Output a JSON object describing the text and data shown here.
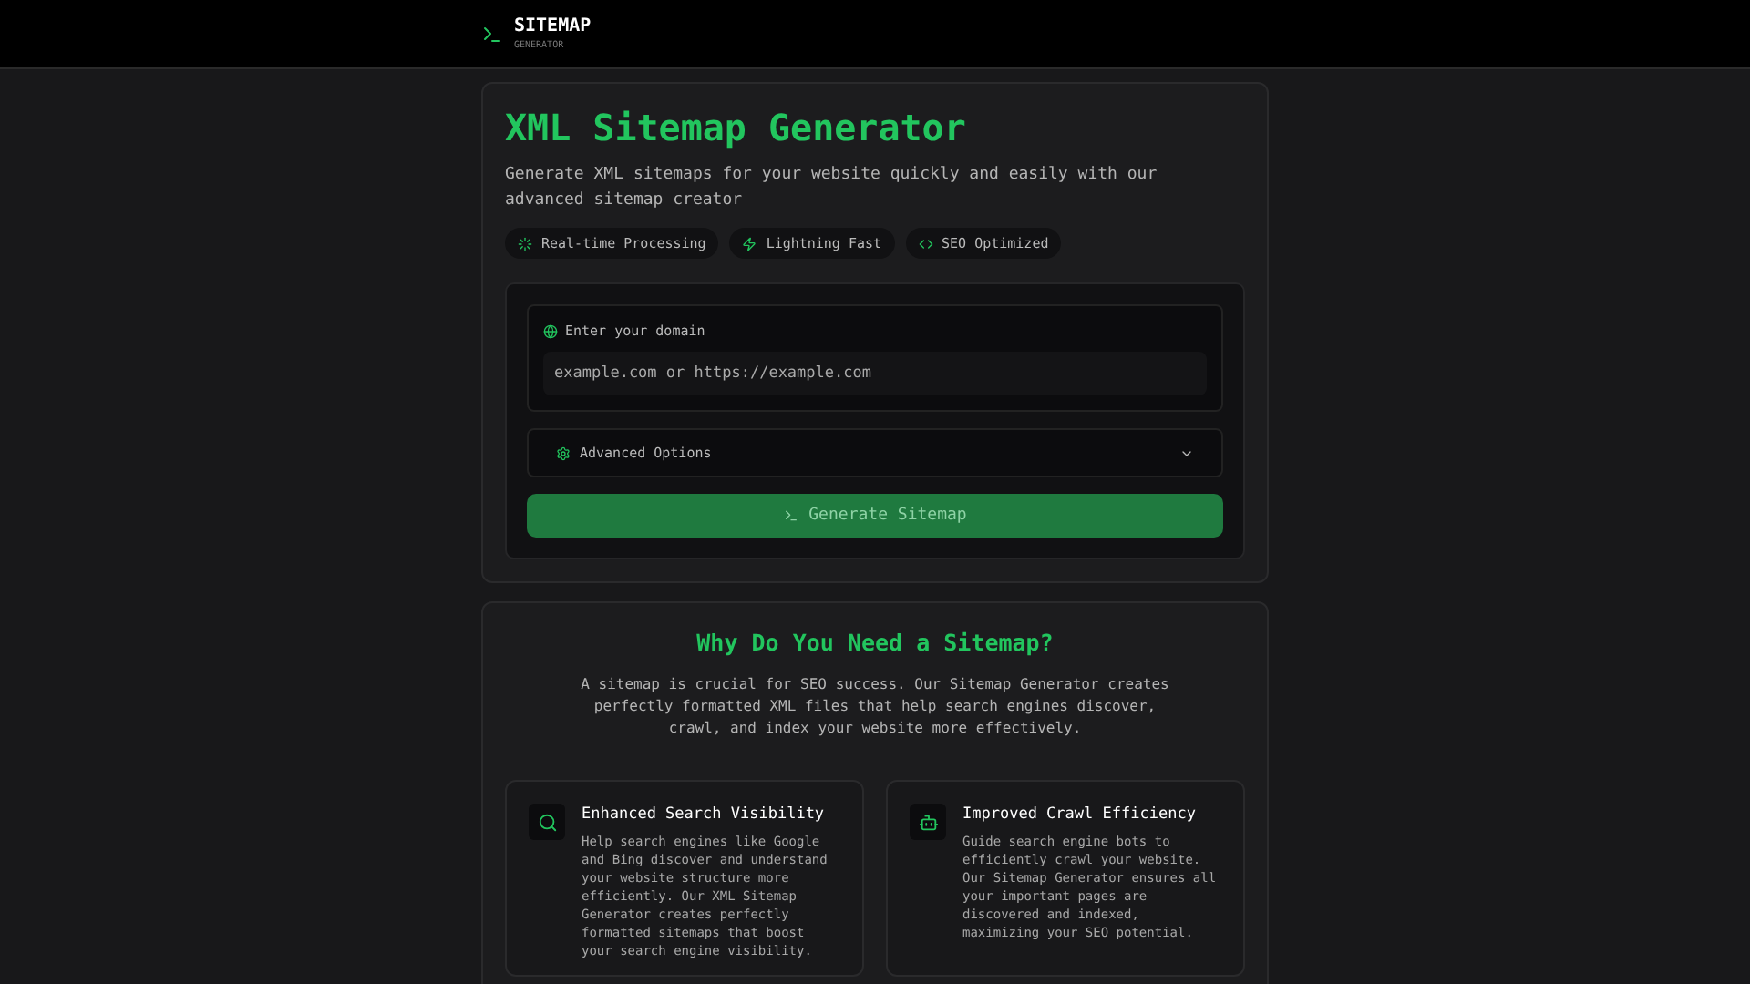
{
  "header": {
    "logo_title": "SITEMAP",
    "logo_subtitle": "GENERATOR"
  },
  "hero": {
    "title": "XML Sitemap Generator",
    "subtitle": "Generate XML sitemaps for your website quickly and easily with our advanced sitemap creator",
    "features": [
      {
        "kind": "realtime",
        "label": "Real-time Processing"
      },
      {
        "kind": "speed",
        "label": "Lightning Fast"
      },
      {
        "kind": "code",
        "label": "SEO Optimized"
      }
    ]
  },
  "form": {
    "domain_label": "Enter your domain",
    "placeholder": "example.com or https://example.com",
    "advanced": {
      "label": "Advanced Options",
      "expanded": false
    },
    "submit": "Generate Sitemap"
  },
  "why": {
    "title": "Why Do You Need a Sitemap?",
    "intro": "A sitemap is crucial for SEO success. Our Sitemap Generator creates perfectly formatted XML files that help search engines discover, crawl, and index your website more effectively.",
    "cards": [
      {
        "kind": "search",
        "title": "Enhanced Search Visibility",
        "text": "Help search engines like Google and Bing discover and understand your website structure more efficiently. Our XML Sitemap Generator creates perfectly formatted sitemaps that boost your search engine visibility."
      },
      {
        "kind": "bot",
        "title": "Improved Crawl Efficiency",
        "text": "Guide search engine bots to efficiently crawl your website. Our Sitemap Generator ensures all your important pages are discovered and indexed, maximizing your SEO potential."
      }
    ]
  }
}
